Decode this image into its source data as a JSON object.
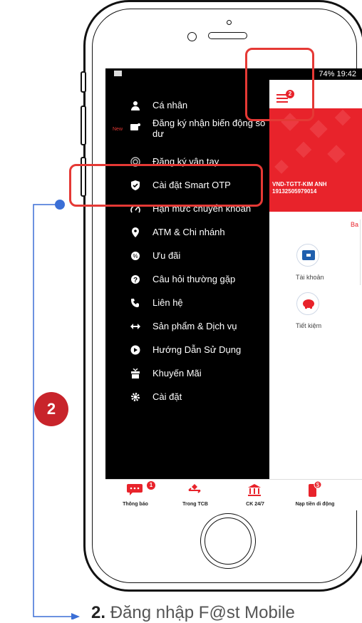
{
  "status_bar": {
    "text": "74% 19:42"
  },
  "menu": {
    "items": [
      {
        "label": "Cá nhân",
        "icon": "person-icon"
      },
      {
        "label": "Đăng ký nhận biến động số dư",
        "icon": "notification-icon",
        "tag": "New"
      },
      {
        "label": "Đăng ký vân tay",
        "icon": "fingerprint-icon"
      },
      {
        "label": "Cài đặt Smart OTP",
        "icon": "shield-check-icon"
      },
      {
        "label": "Hạn mức chuyển khoản",
        "icon": "speedometer-icon"
      },
      {
        "label": "ATM & Chi nhánh",
        "icon": "location-pin-icon"
      },
      {
        "label": "Ưu đãi",
        "icon": "gift-icon"
      },
      {
        "label": "Câu hỏi thường gặp",
        "icon": "question-icon"
      },
      {
        "label": "Liên hệ",
        "icon": "phone-icon"
      },
      {
        "label": "Sản phẩm & Dịch vụ",
        "icon": "arrows-icon"
      },
      {
        "label": "Hướng Dẫn Sử Dụng",
        "icon": "play-icon"
      },
      {
        "label": "Khuyến Mãi",
        "icon": "present-icon"
      },
      {
        "label": "Cài đặt",
        "icon": "gear-icon"
      }
    ]
  },
  "header": {
    "notification_count": "2"
  },
  "account": {
    "name": "VND-TGTT-KIM ANH",
    "number": "19132505979014",
    "partial_text": "Ba"
  },
  "tiles": [
    {
      "label": "Tài khoản",
      "icon": "wallet-icon"
    },
    {
      "label": "Tiết kiệm",
      "icon": "piggy-bank-icon"
    }
  ],
  "tabs": [
    {
      "label": "Thông báo",
      "icon": "chat-icon",
      "badge": "1"
    },
    {
      "label": "Trong TCB",
      "icon": "transfer-icon"
    },
    {
      "label": "CK 24/7",
      "icon": "bank-icon"
    },
    {
      "label": "Nạp tiền di động",
      "icon": "mobile-topup-icon"
    }
  ],
  "annotation": {
    "step": "2",
    "footer_number": "2.",
    "footer_text": "Đăng nhập F@st Mobile"
  },
  "colors": {
    "accent": "#e8232b",
    "highlight": "#e53935",
    "callout_line": "#3b6fd6"
  }
}
